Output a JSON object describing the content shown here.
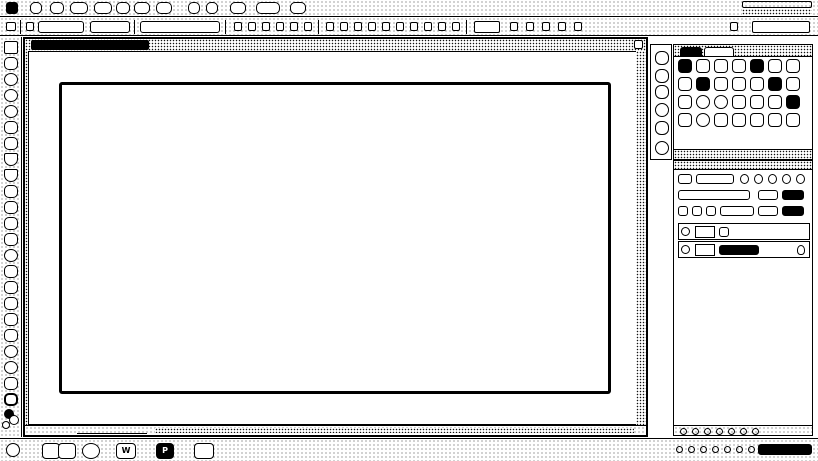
{
  "menubar": {
    "items": [
      {
        "id": "app-logo",
        "label": ""
      },
      {
        "id": "file",
        "label": ""
      },
      {
        "id": "edit",
        "label": ""
      },
      {
        "id": "image",
        "label": ""
      },
      {
        "id": "layer",
        "label": ""
      },
      {
        "id": "type",
        "label": ""
      },
      {
        "id": "select",
        "label": ""
      },
      {
        "id": "filter",
        "label": ""
      },
      {
        "id": "view",
        "label": ""
      },
      {
        "id": "extra",
        "label": ""
      },
      {
        "id": "window",
        "label": ""
      },
      {
        "id": "help",
        "label": ""
      }
    ]
  },
  "options_bar": {
    "tool_icon": "selection-tool-icon",
    "preset_label": "",
    "mode_label": "",
    "action_label": ""
  },
  "document": {
    "tab_title": "",
    "zoom": ""
  },
  "swatches_panel": {
    "tabs": [
      "",
      ""
    ]
  },
  "layers_panel": {
    "blend_mode": "",
    "layers": [
      {
        "name": "",
        "thumbnail": "text-layer"
      },
      {
        "name": "",
        "thumbnail": "background-layer"
      }
    ]
  },
  "taskbar": {
    "apps": [
      {
        "icon": "browser-icon",
        "label": ""
      },
      {
        "icon": "explorer-icon",
        "label": ""
      },
      {
        "icon": "circle-app-icon",
        "label": ""
      },
      {
        "icon": "word-icon",
        "label": "W"
      },
      {
        "icon": "photoshop-icon",
        "label": "P"
      },
      {
        "icon": "paint-icon",
        "label": ""
      }
    ],
    "clock": ""
  },
  "colors": {
    "foreground": "#000000",
    "background": "#ffffff"
  }
}
